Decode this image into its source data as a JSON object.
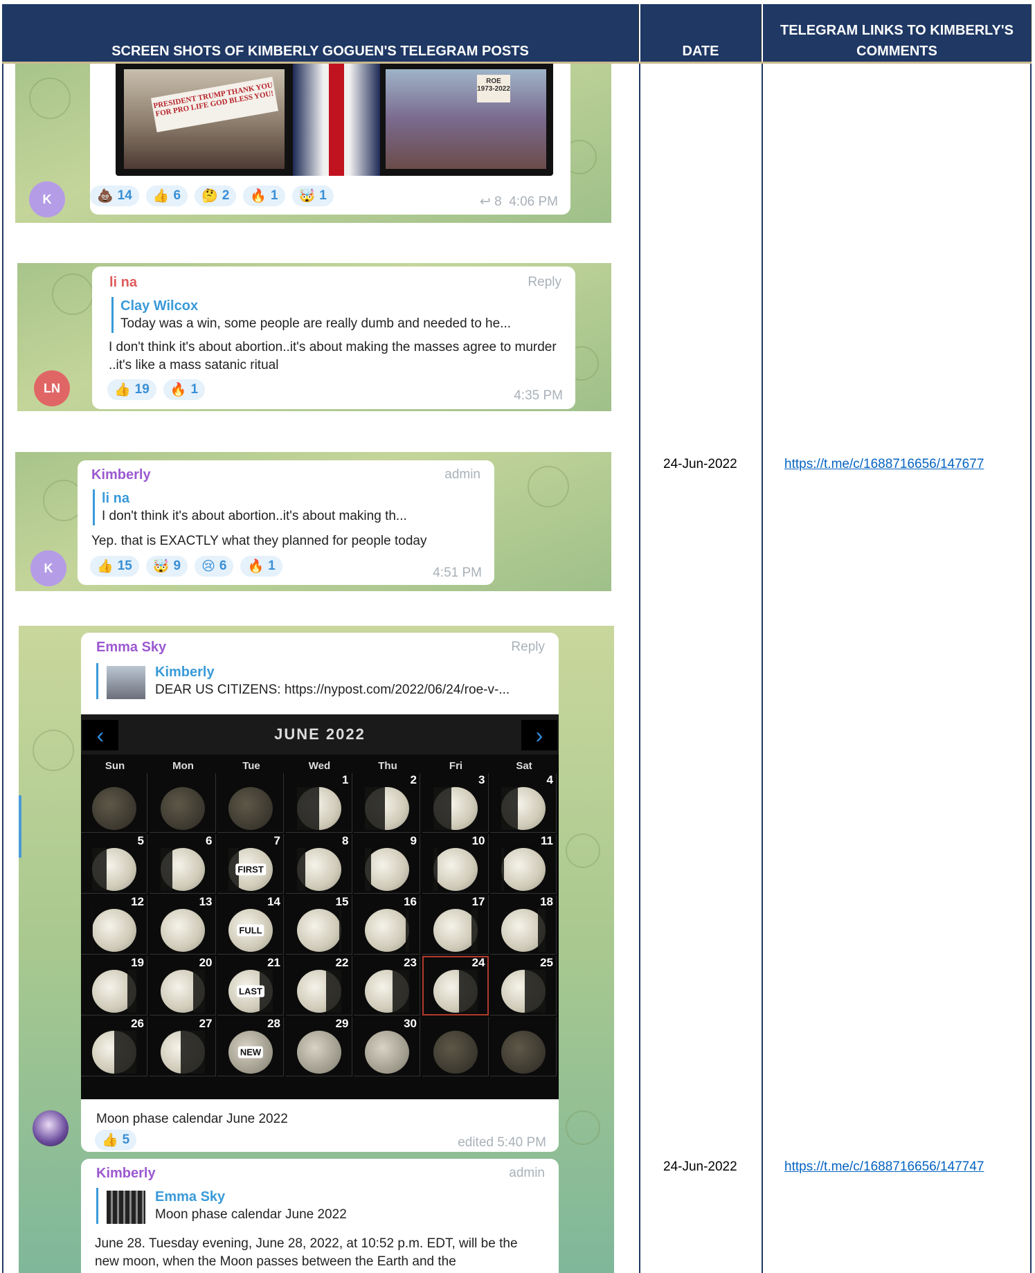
{
  "header": {
    "col1": "SCREEN SHOTS OF KIMBERLY GOGUEN'S TELEGRAM POSTS",
    "col2": "DATE",
    "col3": "TELEGRAM LINKS TO KIMBERLY'S COMMENTS"
  },
  "rows": [
    {
      "date": "24-Jun-2022",
      "link": "https://t.me/c/1688716656/147677"
    },
    {
      "date": "24-Jun-2022",
      "link": "https://t.me/c/1688716656/147747"
    }
  ],
  "post1": {
    "avatar": "K",
    "banner_text": "PRESIDENT TRUMP THANK YOU FOR PRO LIFE GOD BLESS YOU!",
    "sign_text": "ROE 1973-2022",
    "reactions": [
      {
        "emoji": "💩",
        "count": "14"
      },
      {
        "emoji": "👍",
        "count": "6"
      },
      {
        "emoji": "🤔",
        "count": "2"
      },
      {
        "emoji": "🔥",
        "count": "1"
      },
      {
        "emoji": "🤯",
        "count": "1"
      }
    ],
    "forwards": "8",
    "time": "4:06 PM"
  },
  "post2": {
    "avatar": "LN",
    "sender": "li na",
    "action": "Reply",
    "quote_name": "Clay Wilcox",
    "quote_text": "Today was a win, some people are really dumb and needed to he...",
    "body": "I don't think it's about abortion..it's about making the masses agree to murder ..it's like a mass satanic ritual",
    "reactions": [
      {
        "emoji": "👍",
        "count": "19"
      },
      {
        "emoji": "🔥",
        "count": "1"
      }
    ],
    "time": "4:35 PM"
  },
  "post3": {
    "avatar": "K",
    "sender": "Kimberly",
    "role": "admin",
    "quote_name": "li na",
    "quote_text": "I don't think it's about abortion..it's about making th...",
    "body": "Yep. that is EXACTLY what they planned for people today",
    "reactions": [
      {
        "emoji": "👍",
        "count": "15"
      },
      {
        "emoji": "🤯",
        "count": "9"
      },
      {
        "emoji": "😢",
        "count": "6"
      },
      {
        "emoji": "🔥",
        "count": "1"
      }
    ],
    "time": "4:51 PM"
  },
  "post4": {
    "sender": "Emma Sky",
    "action": "Reply",
    "quote_name": "Kimberly",
    "quote_text": "DEAR US CITIZENS: https://nypost.com/2022/06/24/roe-v-...",
    "calendar": {
      "title": "JUNE 2022",
      "prev": "‹",
      "next": "›",
      "days": [
        "Sun",
        "Mon",
        "Tue",
        "Wed",
        "Thu",
        "Fri",
        "Sat"
      ],
      "weeks": [
        [
          "",
          "",
          "",
          "1",
          "2",
          "3",
          "4"
        ],
        [
          "5",
          "6",
          "7",
          "8",
          "9",
          "10",
          "11"
        ],
        [
          "12",
          "13",
          "14",
          "15",
          "16",
          "17",
          "18"
        ],
        [
          "19",
          "20",
          "21",
          "22",
          "23",
          "24",
          "25"
        ],
        [
          "26",
          "27",
          "28",
          "29",
          "30",
          "",
          ""
        ]
      ],
      "labels": {
        "7": "FIRST",
        "14": "FULL",
        "21": "LAST",
        "28": "NEW"
      },
      "highlight": "24"
    },
    "caption": "Moon phase calendar June 2022",
    "reactions": [
      {
        "emoji": "👍",
        "count": "5"
      }
    ],
    "time": "edited 5:40 PM"
  },
  "post5": {
    "sender": "Kimberly",
    "role": "admin",
    "quote_name": "Emma Sky",
    "quote_text": "Moon phase calendar June 2022",
    "body": "June 28. Tuesday evening, June 28, 2022, at 10:52 p.m. EDT, will be the new moon, when the Moon passes between the Earth and the"
  },
  "colors": {
    "header_bg": "#1f3864",
    "link": "#0563c1",
    "kimberly": "#9b59d0",
    "lina": "#e05a5a",
    "emma": "#9b59d0",
    "quote": "#3a9ad9"
  }
}
